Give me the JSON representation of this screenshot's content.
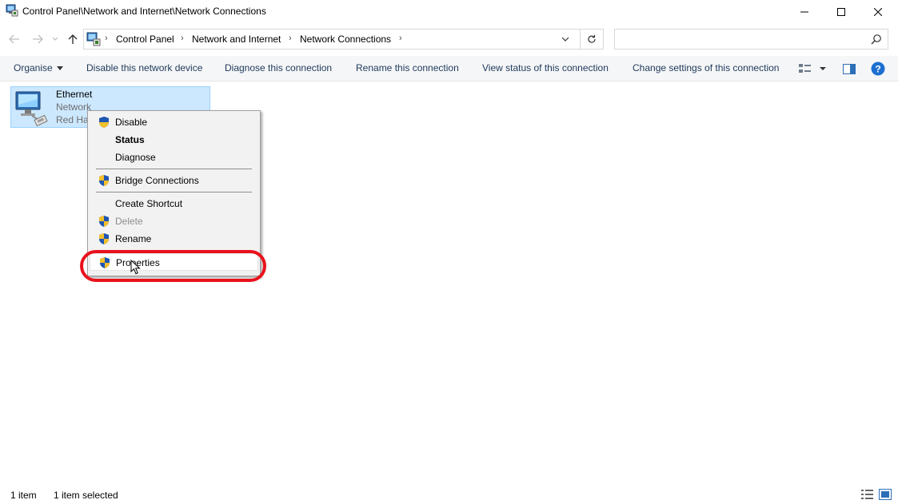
{
  "window": {
    "title": "Control Panel\\Network and Internet\\Network Connections"
  },
  "address": {
    "crumbs": [
      "Control Panel",
      "Network and Internet",
      "Network Connections"
    ],
    "search_placeholder": ""
  },
  "commands": {
    "organise": "Organise",
    "disable_device": "Disable this network device",
    "diagnose": "Diagnose this connection",
    "rename": "Rename this connection",
    "view_status": "View status of this connection",
    "change_settings": "Change settings of this connection"
  },
  "connection": {
    "name": "Ethernet",
    "status": "Network",
    "device": "Red Hat"
  },
  "context_menu": {
    "items": [
      {
        "label": "Disable",
        "shield": true,
        "bold": false,
        "disabled": false
      },
      {
        "label": "Status",
        "shield": false,
        "bold": true,
        "disabled": false
      },
      {
        "label": "Diagnose",
        "shield": false,
        "bold": false,
        "disabled": false
      },
      {
        "label": "Bridge Connections",
        "shield": true,
        "bold": false,
        "disabled": false
      },
      {
        "label": "Create Shortcut",
        "shield": false,
        "bold": false,
        "disabled": false
      },
      {
        "label": "Delete",
        "shield": true,
        "bold": false,
        "disabled": true
      },
      {
        "label": "Rename",
        "shield": true,
        "bold": false,
        "disabled": false
      },
      {
        "label": "Properties",
        "shield": true,
        "bold": false,
        "disabled": false
      }
    ]
  },
  "statusbar": {
    "count": "1 item",
    "selected": "1 item selected"
  },
  "colors": {
    "selection_fill": "#cce8ff",
    "selection_border": "#99d1ff",
    "command_text": "#1e395b",
    "annotation_ring": "#e8121c"
  },
  "icons": [
    "network-connections-icon",
    "minimize-icon",
    "maximize-icon",
    "close-icon",
    "back-arrow-icon",
    "forward-arrow-icon",
    "recent-locations-icon",
    "up-arrow-icon",
    "chevron-right-icon",
    "chevron-down-icon",
    "refresh-icon",
    "search-icon",
    "change-view-icon",
    "preview-pane-icon",
    "help-icon",
    "ethernet-adapter-icon",
    "uac-shield-icon",
    "mouse-pointer-icon",
    "details-view-icon",
    "large-icons-view-icon"
  ]
}
